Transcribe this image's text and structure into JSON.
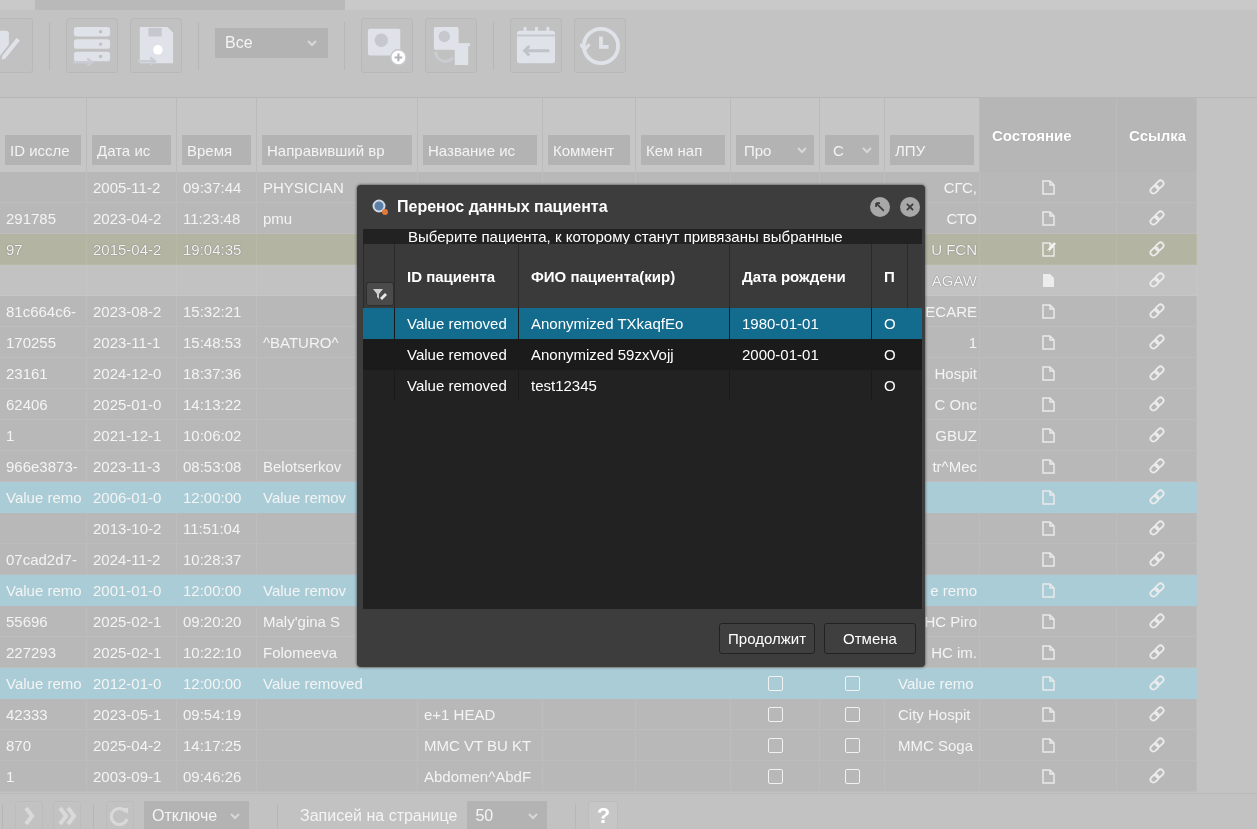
{
  "toolbar": {
    "filter": {
      "value": "Все"
    }
  },
  "grid": {
    "columns": [
      {
        "kind": "input",
        "placeholder": "ID иссле"
      },
      {
        "kind": "input",
        "placeholder": "Дата ис"
      },
      {
        "kind": "input",
        "placeholder": "Время"
      },
      {
        "kind": "input",
        "placeholder": "Направивший вр"
      },
      {
        "kind": "input",
        "placeholder": "Название ис"
      },
      {
        "kind": "input",
        "placeholder": "Коммент"
      },
      {
        "kind": "input",
        "placeholder": "Кем нап"
      },
      {
        "kind": "select",
        "value": "Про"
      },
      {
        "kind": "select",
        "value": "С"
      },
      {
        "kind": "input",
        "placeholder": "ЛПУ"
      },
      {
        "kind": "label",
        "label": "Состояние"
      },
      {
        "kind": "label",
        "label": "Ссылка"
      }
    ],
    "rows": [
      {
        "selected": false,
        "hovered": false,
        "marked": false,
        "edited": false,
        "draft": false,
        "date": "2005-11-2",
        "time": "09:37:44",
        "referrer": "PHYSICIAN",
        "lpu": "СГС,",
        "lpu_covered": true
      },
      {
        "selected": false,
        "hovered": false,
        "marked": false,
        "edited": false,
        "draft": false,
        "id": "291785",
        "date": "2023-04-2",
        "time": "11:23:48",
        "referrer": "pmu",
        "lpu": "СТО",
        "lpu_covered": true
      },
      {
        "selected": true,
        "hovered": false,
        "marked": false,
        "edited": true,
        "draft": false,
        "id": "97",
        "date": "2015-04-2",
        "time": "19:04:35",
        "lpu": "U FCN",
        "lpu_covered": true
      },
      {
        "selected": false,
        "hovered": true,
        "marked": false,
        "edited": false,
        "draft": true,
        "lpu": "AGAW",
        "lpu_covered": true
      },
      {
        "selected": false,
        "hovered": false,
        "marked": false,
        "edited": false,
        "draft": false,
        "id": "81c664c6-",
        "date": "2023-08-2",
        "time": "15:32:21",
        "lpu": "ECARE",
        "lpu_covered": true
      },
      {
        "selected": false,
        "hovered": false,
        "marked": false,
        "edited": false,
        "draft": false,
        "id": "170255",
        "date": "2023-11-1",
        "time": "15:48:53",
        "referrer": "^BATURO^",
        "lpu": "1",
        "lpu_covered": true
      },
      {
        "selected": false,
        "hovered": false,
        "marked": false,
        "edited": false,
        "draft": false,
        "id": "23161",
        "date": "2024-12-0",
        "time": "18:37:36",
        "lpu": "Hospit",
        "lpu_covered": true
      },
      {
        "selected": false,
        "hovered": false,
        "marked": false,
        "edited": false,
        "draft": false,
        "id": "62406",
        "date": "2025-01-0",
        "time": "14:13:22",
        "lpu": "C Onc",
        "lpu_covered": true
      },
      {
        "selected": false,
        "hovered": false,
        "marked": false,
        "edited": false,
        "draft": false,
        "id": "1",
        "date": "2021-12-1",
        "time": "10:06:02",
        "lpu": "GBUZ",
        "lpu_covered": true
      },
      {
        "selected": false,
        "hovered": false,
        "marked": false,
        "edited": false,
        "draft": false,
        "id": "966e3873-",
        "date": "2023-11-3",
        "time": "08:53:08",
        "referrer": "Belotserkov",
        "lpu": "tr^Mec",
        "lpu_covered": true
      },
      {
        "selected": false,
        "hovered": false,
        "marked": true,
        "edited": false,
        "draft": false,
        "id": "Value remo",
        "date": "2006-01-0",
        "time": "12:00:00",
        "referrer": "Value remov"
      },
      {
        "selected": false,
        "hovered": false,
        "marked": false,
        "edited": false,
        "draft": false,
        "date": "2013-10-2",
        "time": "11:51:04"
      },
      {
        "selected": false,
        "hovered": false,
        "marked": false,
        "edited": false,
        "draft": false,
        "id": "07cad2d7-",
        "date": "2024-11-2",
        "time": "10:28:37"
      },
      {
        "selected": false,
        "hovered": false,
        "marked": true,
        "edited": false,
        "draft": false,
        "id": "Value remo",
        "date": "2001-01-0",
        "time": "12:00:00",
        "referrer": "Value remov",
        "lpu": "e remo",
        "lpu_covered": true
      },
      {
        "selected": false,
        "hovered": false,
        "marked": false,
        "edited": false,
        "draft": false,
        "id": "55696",
        "date": "2025-02-1",
        "time": "09:20:20",
        "referrer": "Maly'gina S",
        "lpu": "HC Piro",
        "lpu_covered": true
      },
      {
        "selected": false,
        "hovered": false,
        "marked": false,
        "edited": false,
        "draft": false,
        "id": "227293",
        "date": "2025-02-1",
        "time": "10:22:10",
        "referrer": "Folomeeva",
        "lpu": "HC im.",
        "lpu_covered": true
      },
      {
        "selected": false,
        "hovered": false,
        "marked": true,
        "edited": false,
        "draft": false,
        "id": "Value remo",
        "date": "2012-01-0",
        "time": "12:00:00",
        "referrer": "Value removed",
        "checks": [
          {
            "checked": false
          },
          {
            "checked": false
          }
        ],
        "lpu": "Value remo"
      },
      {
        "selected": false,
        "hovered": false,
        "marked": false,
        "edited": false,
        "draft": false,
        "id": "42333",
        "date": "2023-05-1",
        "time": "09:54:19",
        "study": "e+1 HEAD",
        "checks": [
          {
            "checked": false
          },
          {
            "checked": false
          }
        ],
        "lpu": "City Hospit"
      },
      {
        "selected": false,
        "hovered": false,
        "marked": false,
        "edited": false,
        "draft": false,
        "id": "870",
        "date": "2025-04-2",
        "time": "14:17:25",
        "study": "MMC VT BU KT",
        "checks": [
          {
            "checked": false
          },
          {
            "checked": false
          }
        ],
        "lpu": "MMC Soga"
      },
      {
        "selected": false,
        "hovered": false,
        "marked": false,
        "edited": false,
        "draft": false,
        "id": "1",
        "date": "2003-09-1",
        "time": "09:46:26",
        "study": "Abdomen^AbdF",
        "checks": [
          {
            "checked": false
          },
          {
            "checked": false
          }
        ]
      }
    ]
  },
  "pager": {
    "mode": "Отключе",
    "page_size_label": "Записей на странице",
    "page_size": "50",
    "help": "?"
  },
  "dialog": {
    "title": "Перенос данных пациента",
    "instruction": "Выберите пациента, к которому станут привязаны выбранные",
    "columns": [
      "ID пациента",
      "ФИО пациента(кир)",
      "Дата рождени",
      "П"
    ],
    "rows": [
      {
        "selected": true,
        "cells": [
          "Value removed",
          "Anonymized TXkaqfEo",
          "1980-01-01",
          "O"
        ]
      },
      {
        "selected": false,
        "cells": [
          "Value removed",
          "Anonymized 59zxVojj",
          "2000-01-01",
          "O"
        ]
      },
      {
        "selected": false,
        "cells": [
          "Value removed",
          "test12345",
          "",
          "O"
        ]
      }
    ],
    "buttons": [
      "Продолжит",
      "Отмена"
    ]
  }
}
